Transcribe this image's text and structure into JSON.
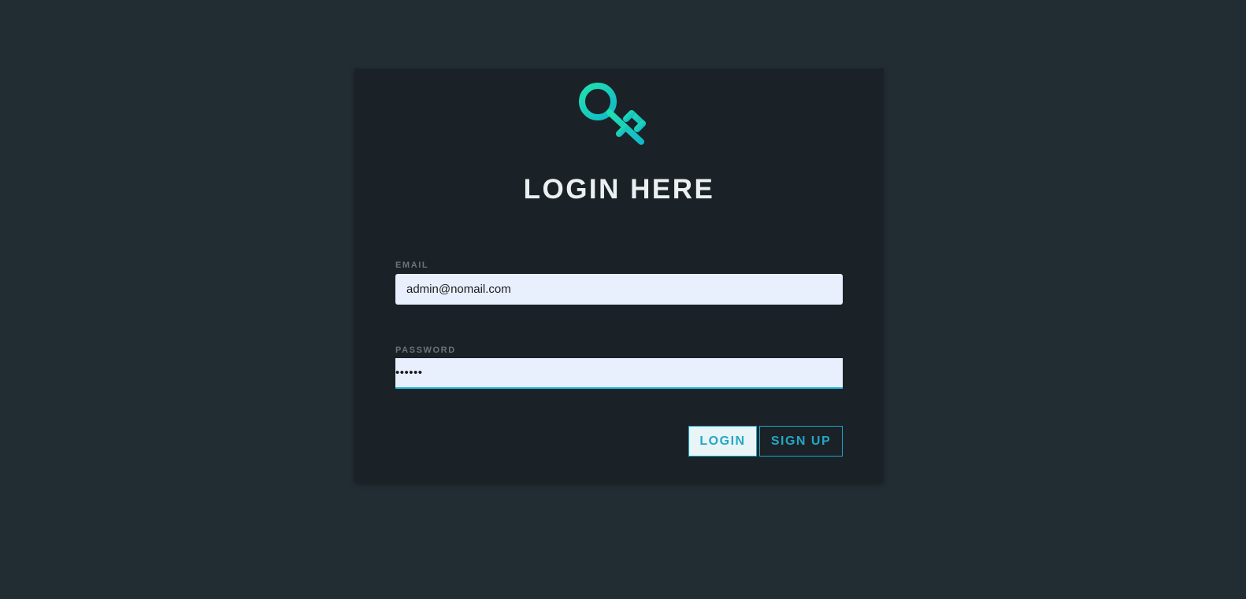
{
  "colors": {
    "page_background": "#222d33",
    "card_background": "#1b2227",
    "accent": "#1aa6c4",
    "logo_gradient_start": "#21e0b0",
    "logo_gradient_end": "#12b8c7",
    "input_background": "#e8f0fe"
  },
  "logo": {
    "icon": "key-icon"
  },
  "login": {
    "title": "LOGIN HERE",
    "email": {
      "label": "EMAIL",
      "value": "admin@nomail.com"
    },
    "password": {
      "label": "PASSWORD",
      "value": "••••••"
    },
    "login_button": "LOGIN",
    "signup_button": "SIGN UP"
  }
}
